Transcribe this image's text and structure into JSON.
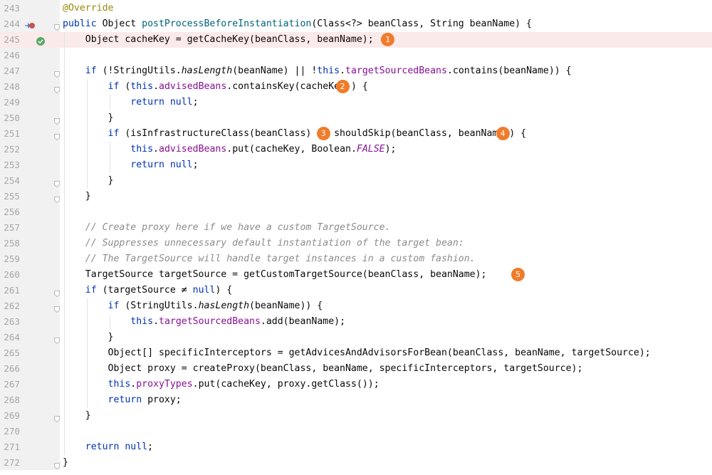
{
  "editor": {
    "lines": [
      {
        "n": "243",
        "tokens": [
          [
            "ann",
            "@Override"
          ]
        ]
      },
      {
        "n": "244",
        "tokens": [
          [
            "kw",
            "public "
          ],
          [
            "",
            "Object "
          ],
          [
            "fn",
            "postProcessBeforeInstantiation"
          ],
          [
            "",
            "(Class<?> beanClass, String beanName) {"
          ]
        ],
        "icon": "implements-gutter-icon"
      },
      {
        "n": "245",
        "tokens": [
          [
            "",
            "    Object cacheKey = getCacheKey(beanClass, beanName);"
          ]
        ],
        "highlight": true,
        "icon": "breakpoint-check-icon"
      },
      {
        "n": "246",
        "tokens": []
      },
      {
        "n": "247",
        "tokens": [
          [
            "kw",
            "    if "
          ],
          [
            "",
            "(!StringUtils."
          ],
          [
            "ital",
            "hasLength"
          ],
          [
            "",
            "(beanName) || !"
          ],
          [
            "kw",
            "this"
          ],
          [
            "",
            "."
          ],
          [
            "field",
            "targetSourcedBeans"
          ],
          [
            "",
            ".contains(beanName)) {"
          ]
        ]
      },
      {
        "n": "248",
        "tokens": [
          [
            "kw",
            "        if "
          ],
          [
            "",
            "("
          ],
          [
            "kw",
            "this"
          ],
          [
            "",
            "."
          ],
          [
            "field",
            "advisedBeans"
          ],
          [
            "",
            ".containsKey(cacheKey)) {"
          ]
        ]
      },
      {
        "n": "249",
        "tokens": [
          [
            "kw",
            "            return null"
          ],
          [
            "",
            ";"
          ]
        ]
      },
      {
        "n": "250",
        "tokens": [
          [
            "",
            "        }"
          ]
        ]
      },
      {
        "n": "251",
        "tokens": [
          [
            "kw",
            "        if "
          ],
          [
            "",
            "(isInfrastructureClass(beanClass) || shouldSkip(beanClass, beanName)) {"
          ]
        ]
      },
      {
        "n": "252",
        "tokens": [
          [
            "kw",
            "            this"
          ],
          [
            "",
            "."
          ],
          [
            "field",
            "advisedBeans"
          ],
          [
            "",
            ".put(cacheKey, Boolean."
          ],
          [
            "const",
            "FALSE"
          ],
          [
            "",
            ");"
          ]
        ]
      },
      {
        "n": "253",
        "tokens": [
          [
            "kw",
            "            return null"
          ],
          [
            "",
            ";"
          ]
        ]
      },
      {
        "n": "254",
        "tokens": [
          [
            "",
            "        }"
          ]
        ]
      },
      {
        "n": "255",
        "tokens": [
          [
            "",
            "    }"
          ]
        ]
      },
      {
        "n": "256",
        "tokens": []
      },
      {
        "n": "257",
        "tokens": [
          [
            "com",
            "    // Create proxy here if we have a custom TargetSource."
          ]
        ]
      },
      {
        "n": "258",
        "tokens": [
          [
            "com",
            "    // Suppresses unnecessary default instantiation of the target bean:"
          ]
        ]
      },
      {
        "n": "259",
        "tokens": [
          [
            "com",
            "    // The TargetSource will handle target instances in a custom fashion."
          ]
        ]
      },
      {
        "n": "260",
        "tokens": [
          [
            "",
            "    TargetSource targetSource = getCustomTargetSource(beanClass, beanName);"
          ]
        ]
      },
      {
        "n": "261",
        "tokens": [
          [
            "kw",
            "    if "
          ],
          [
            "",
            "(targetSource ≠ "
          ],
          [
            "kw",
            "null"
          ],
          [
            "",
            ") {"
          ]
        ]
      },
      {
        "n": "262",
        "tokens": [
          [
            "kw",
            "        if "
          ],
          [
            "",
            "(StringUtils."
          ],
          [
            "ital",
            "hasLength"
          ],
          [
            "",
            "(beanName)) {"
          ]
        ]
      },
      {
        "n": "263",
        "tokens": [
          [
            "kw",
            "            this"
          ],
          [
            "",
            "."
          ],
          [
            "field",
            "targetSourcedBeans"
          ],
          [
            "",
            ".add(beanName);"
          ]
        ]
      },
      {
        "n": "264",
        "tokens": [
          [
            "",
            "        }"
          ]
        ]
      },
      {
        "n": "265",
        "tokens": [
          [
            "",
            "        Object[] specificInterceptors = getAdvicesAndAdvisorsForBean(beanClass, beanName, targetSource);"
          ]
        ]
      },
      {
        "n": "266",
        "tokens": [
          [
            "",
            "        Object proxy = createProxy(beanClass, beanName, specificInterceptors, targetSource);"
          ]
        ]
      },
      {
        "n": "267",
        "tokens": [
          [
            "kw",
            "        this"
          ],
          [
            "",
            "."
          ],
          [
            "field",
            "proxyTypes"
          ],
          [
            "",
            ".put(cacheKey, proxy.getClass());"
          ]
        ]
      },
      {
        "n": "268",
        "tokens": [
          [
            "kw",
            "        return "
          ],
          [
            "",
            "proxy;"
          ]
        ]
      },
      {
        "n": "269",
        "tokens": [
          [
            "",
            "    }"
          ]
        ]
      },
      {
        "n": "270",
        "tokens": []
      },
      {
        "n": "271",
        "tokens": [
          [
            "kw",
            "    return null"
          ],
          [
            "",
            ";"
          ]
        ]
      },
      {
        "n": "272",
        "tokens": [
          [
            "",
            "}"
          ]
        ]
      }
    ],
    "badges": [
      {
        "label": "1",
        "line": "245"
      },
      {
        "label": "2",
        "line": "248"
      },
      {
        "label": "3",
        "line": "251"
      },
      {
        "label": "4",
        "line": "251"
      },
      {
        "label": "5",
        "line": "260"
      }
    ],
    "colors": {
      "gutter_bg": "#f1f1f1",
      "highlight_bg": "#fbeaea",
      "badge": "#f07c2b",
      "keyword": "#0033b3",
      "annotation": "#9e880d",
      "method_decl": "#00627a",
      "field": "#871094",
      "comment": "#8c8c8c"
    }
  }
}
